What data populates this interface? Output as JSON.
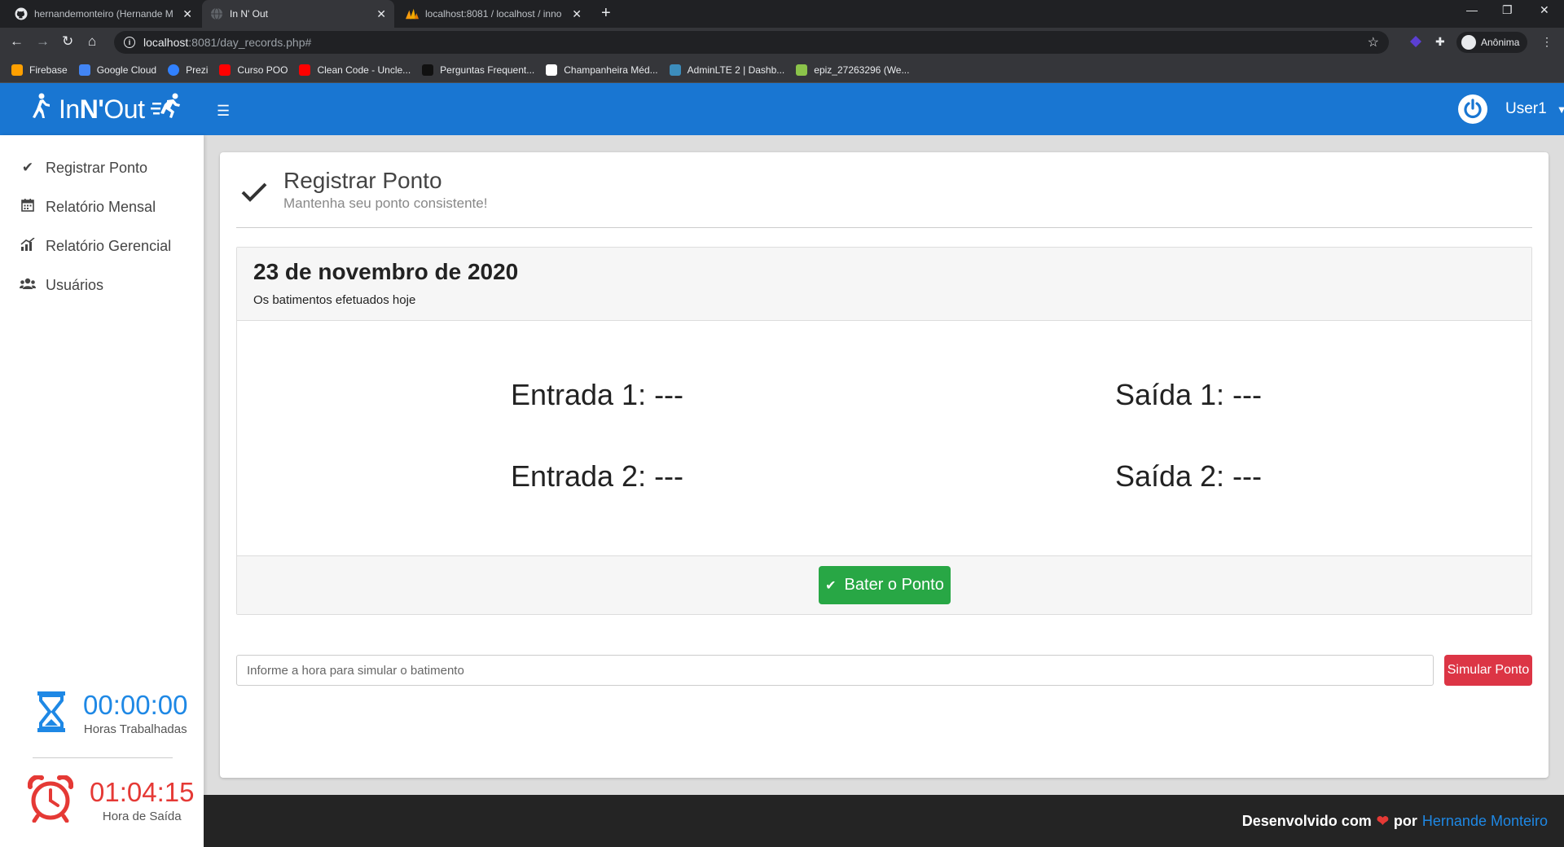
{
  "browser": {
    "tabs": [
      {
        "title": "hernandemonteiro (Hernande M",
        "active": false,
        "icon": "github-icon"
      },
      {
        "title": "In N' Out",
        "active": true,
        "icon": "globe-icon"
      },
      {
        "title": "localhost:8081 / localhost / inno",
        "active": false,
        "icon": "phpmyadmin-icon"
      }
    ],
    "url_host": "localhost",
    "url_rest": ":8081/day_records.php#",
    "profile_label": "Anônima",
    "bookmarks": [
      {
        "label": "Firebase",
        "color": "#ffa000"
      },
      {
        "label": "Google Cloud",
        "color": "#4285f4"
      },
      {
        "label": "Prezi",
        "color": "#3181ff"
      },
      {
        "label": "Curso POO",
        "color": "#ff0000"
      },
      {
        "label": "Clean Code - Uncle...",
        "color": "#ff0000"
      },
      {
        "label": "Perguntas Frequent...",
        "color": "#111111"
      },
      {
        "label": "Champanheira Méd...",
        "color": "#ffffff"
      },
      {
        "label": "AdminLTE 2 | Dashb...",
        "color": "#3c8dbc"
      },
      {
        "label": "epiz_27263296 (We...",
        "color": "#8bc34a"
      }
    ]
  },
  "app": {
    "logo_prefix": "In ",
    "logo_bold": "N'",
    "logo_suffix": " Out",
    "user_name": "User1",
    "brand_color": "#1976d2"
  },
  "sidebar": {
    "items": [
      {
        "label": "Registrar Ponto",
        "icon": "check-icon"
      },
      {
        "label": "Relatório Mensal",
        "icon": "calendar-icon"
      },
      {
        "label": "Relatório Gerencial",
        "icon": "chart-icon"
      },
      {
        "label": "Usuários",
        "icon": "users-icon"
      }
    ],
    "worked_hours": {
      "value": "00:00:00",
      "label": "Horas Trabalhadas",
      "color": "#1e88e5"
    },
    "exit_time": {
      "value": "01:04:15",
      "label": "Hora de Saída",
      "color": "#e53935"
    }
  },
  "page": {
    "title": "Registrar Ponto",
    "subtitle": "Mantenha seu ponto consistente!"
  },
  "panel": {
    "date": "23 de novembro de 2020",
    "description": "Os batimentos efetuados hoje",
    "entrada1": "Entrada 1: ---",
    "saida1": "Saída 1: ---",
    "entrada2": "Entrada 2: ---",
    "saida2": "Saída 2: ---",
    "punch_button": "Bater o Ponto"
  },
  "simulate": {
    "placeholder": "Informe a hora para simular o batimento",
    "button": "Simular Ponto"
  },
  "footer": {
    "text_prefix": "Desenvolvido com",
    "text_by": "por",
    "author": "Hernande Monteiro"
  }
}
